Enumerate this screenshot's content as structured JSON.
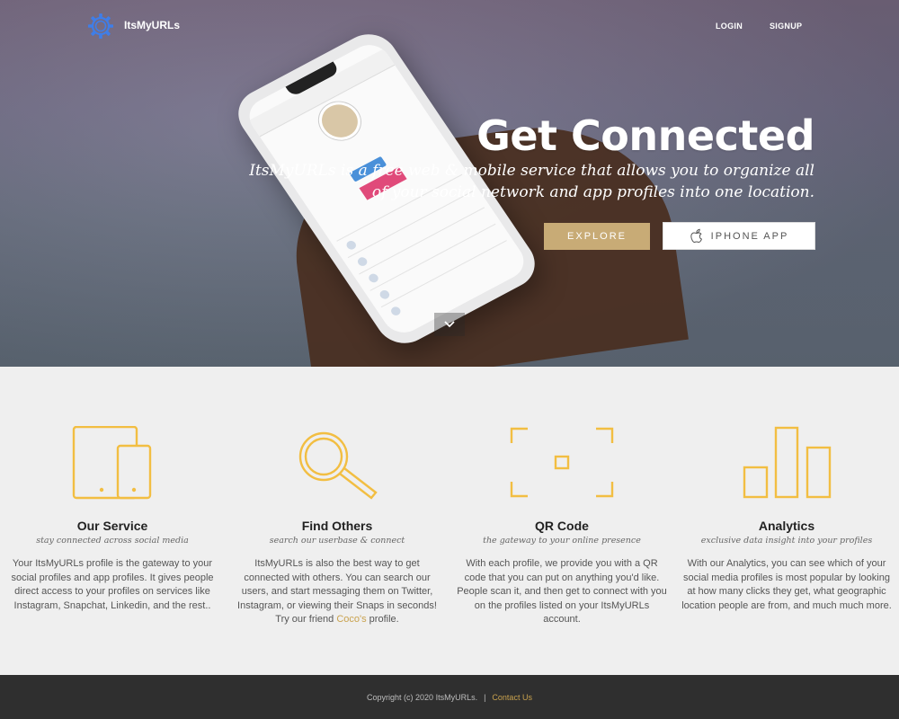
{
  "nav": {
    "brand": "ItsMyURLs",
    "login": "LOGIN",
    "signup": "SIGNUP"
  },
  "hero": {
    "headline": "Get Connected",
    "subline": "ItsMyURLs is a free web & mobile service that allows you to organize all of your social network and app profiles into one location.",
    "explore_label": "EXPLORE",
    "iphone_label": "IPHONE APP"
  },
  "features": [
    {
      "title": "Our Service",
      "subtitle": "stay connected across social media",
      "desc": "Your ItsMyURLs profile is the gateway to your social profiles and app profiles.  It gives people direct access to your profiles on services like Instagram, Snapchat, Linkedin, and the rest..",
      "icon": "devices-icon"
    },
    {
      "title": "Find Others",
      "subtitle": "search our userbase & connect",
      "desc_before": "ItsMyURLs is also the best way to get connected with others.  You can search our users, and start messaging them on Twitter, Instagram, or viewing their Snaps in seconds!  Try our friend ",
      "desc_link": "Coco's",
      "desc_after": " profile.",
      "icon": "magnifier-icon"
    },
    {
      "title": "QR Code",
      "subtitle": "the gateway to your online presence",
      "desc": "With each profile, we provide you with a QR code that you can put on anything you'd like.  People scan it, and then get to connect with you on the profiles listed on your ItsMyURLs account.",
      "icon": "qr-scan-icon"
    },
    {
      "title": "Analytics",
      "subtitle": "exclusive data insight into your profiles",
      "desc": "With our Analytics, you can see which of your social media profiles is most popular by looking at how many clicks they get, what geographic location people are from, and much much more.",
      "icon": "bar-chart-icon"
    }
  ],
  "footer": {
    "copyright": "Copyright (c) 2020 ItsMyURLs.",
    "separator": "|",
    "contact": "Contact Us"
  },
  "colors": {
    "accent": "#c8ab76",
    "icon_gold": "#f2be42",
    "footer_bg": "#2f2f2f"
  }
}
